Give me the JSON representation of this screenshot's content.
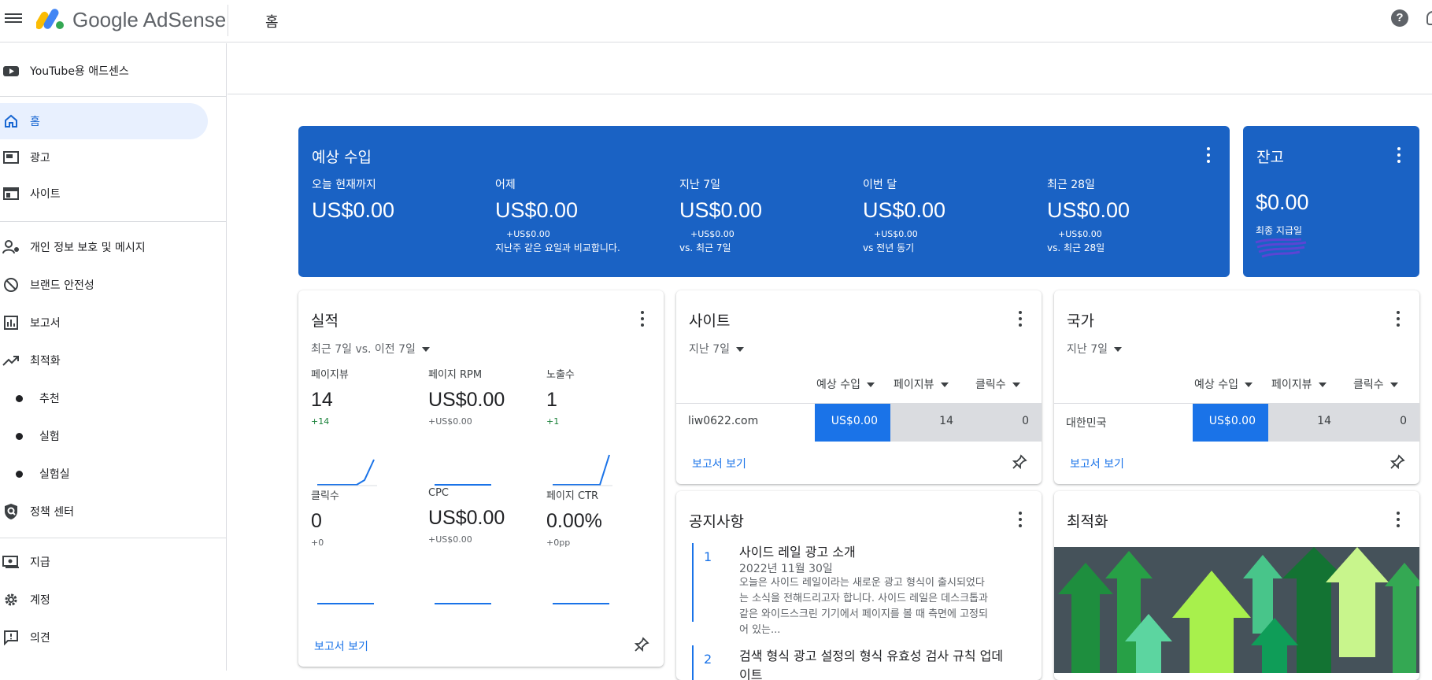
{
  "header": {
    "brand": "Google AdSense",
    "page_title": "홈",
    "help_icon": "?"
  },
  "sidebar": {
    "youtube": "YouTube용 애드센스",
    "home": "홈",
    "ads": "광고",
    "sites": "사이트",
    "privacy": "개인 정보 보호 및 메시지",
    "brand_safety": "브랜드 안전성",
    "reports": "보고서",
    "optimization": "최적화",
    "recommendations": "추천",
    "experiments": "실험",
    "labs": "실험실",
    "policy_center": "정책 센터",
    "payments": "지급",
    "account": "계정",
    "feedback": "의견"
  },
  "earnings": {
    "title": "예상 수입",
    "metrics": [
      {
        "label": "오늘 현재까지",
        "value": "US$0.00",
        "delta": "",
        "compare": ""
      },
      {
        "label": "어제",
        "value": "US$0.00",
        "delta": "+US$0.00",
        "compare": "지난주 같은 요일과 비교합니다."
      },
      {
        "label": "지난 7일",
        "value": "US$0.00",
        "delta": "+US$0.00",
        "compare": "vs. 최근 7일"
      },
      {
        "label": "이번 달",
        "value": "US$0.00",
        "delta": "+US$0.00",
        "compare": "vs 전년 동기"
      },
      {
        "label": "최근 28일",
        "value": "US$0.00",
        "delta": "+US$0.00",
        "compare": "vs. 최근 28일"
      }
    ]
  },
  "balance": {
    "title": "잔고",
    "value": "$0.00",
    "last_payment_label": "최종 지급일"
  },
  "performance": {
    "title": "실적",
    "range": "최근 7일 vs. 이전 7일",
    "metrics": [
      {
        "label": "페이지뷰",
        "value": "14",
        "delta": "+14"
      },
      {
        "label": "페이지 RPM",
        "value": "US$0.00",
        "delta": "+US$0.00"
      },
      {
        "label": "노출수",
        "value": "1",
        "delta": "+1"
      },
      {
        "label": "클릭수",
        "value": "0",
        "delta": "+0"
      },
      {
        "label": "CPC",
        "value": "US$0.00",
        "delta": "+US$0.00"
      },
      {
        "label": "페이지 CTR",
        "value": "0.00%",
        "delta": "+0pp"
      }
    ],
    "report_link": "보고서 보기"
  },
  "sites_card": {
    "title": "사이트",
    "range": "지난 7일",
    "columns": [
      "예상 수입",
      "페이지뷰",
      "클릭수"
    ],
    "row": {
      "name": "liw0622.com",
      "earnings": "US$0.00",
      "pageviews": "14",
      "clicks": "0"
    },
    "report_link": "보고서 보기"
  },
  "countries_card": {
    "title": "국가",
    "range": "지난 7일",
    "columns": [
      "예상 수입",
      "페이지뷰",
      "클릭수"
    ],
    "row": {
      "name": "대한민국",
      "earnings": "US$0.00",
      "pageviews": "14",
      "clicks": "0"
    },
    "report_link": "보고서 보기"
  },
  "notices": {
    "title": "공지사항",
    "items": [
      {
        "num": "1",
        "title": "사이드 레일 광고 소개",
        "date": "2022년 11월 30일",
        "body_lines": [
          "오늘은 사이드 레일이라는 새로운 광고 형식이 출시되었다",
          "는 소식을 전해드리고자 합니다. 사이드 레일은 데스크톱과",
          "같은 와이드스크린 기기에서 페이지를 볼 때 측면에 고정되",
          "어 있는..."
        ]
      },
      {
        "num": "2",
        "title": "검색 형식 광고 설정의 형식 유효성 검사 규칙 업데",
        "title_line2": "이트"
      }
    ]
  },
  "optimization_card": {
    "title": "최적화"
  },
  "colors": {
    "primary_blue": "#1a62c4",
    "link_blue": "#1a73e8",
    "active_nav_bg": "#e8f0fe",
    "positive_green": "#188038"
  }
}
